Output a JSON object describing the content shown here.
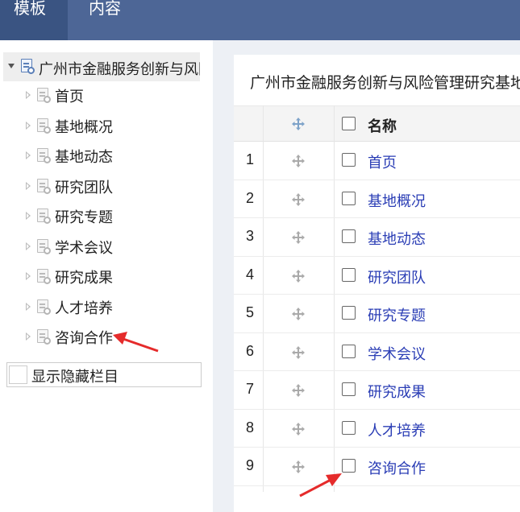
{
  "topbar": {
    "tabs": [
      {
        "label": "模板"
      },
      {
        "label": "内容"
      }
    ]
  },
  "tree": {
    "root_label": "广州市金融服务创新与风险管理研究基地",
    "items": [
      {
        "label": "首页"
      },
      {
        "label": "基地概况"
      },
      {
        "label": "基地动态"
      },
      {
        "label": "研究团队"
      },
      {
        "label": "研究专题"
      },
      {
        "label": "学术会议"
      },
      {
        "label": "研究成果"
      },
      {
        "label": "人才培养"
      },
      {
        "label": "咨询合作"
      }
    ],
    "show_hidden_label": "显示隐藏栏目"
  },
  "content": {
    "title": "广州市金融服务创新与风险管理研究基地",
    "columns": {
      "name": "名称"
    },
    "rows": [
      {
        "num": "1",
        "name": "首页"
      },
      {
        "num": "2",
        "name": "基地概况"
      },
      {
        "num": "3",
        "name": "基地动态"
      },
      {
        "num": "4",
        "name": "研究团队"
      },
      {
        "num": "5",
        "name": "研究专题"
      },
      {
        "num": "6",
        "name": "学术会议"
      },
      {
        "num": "7",
        "name": "研究成果"
      },
      {
        "num": "8",
        "name": "人才培养"
      },
      {
        "num": "9",
        "name": "咨询合作"
      }
    ]
  },
  "colors": {
    "topbar": "#4d6696",
    "active_tab": "#3a5482",
    "link": "#2a3db5",
    "annotation_arrow": "#e52b2b"
  },
  "icons": [
    "page-settings-icon",
    "move-icon",
    "checkbox",
    "expand-caret-icon"
  ]
}
